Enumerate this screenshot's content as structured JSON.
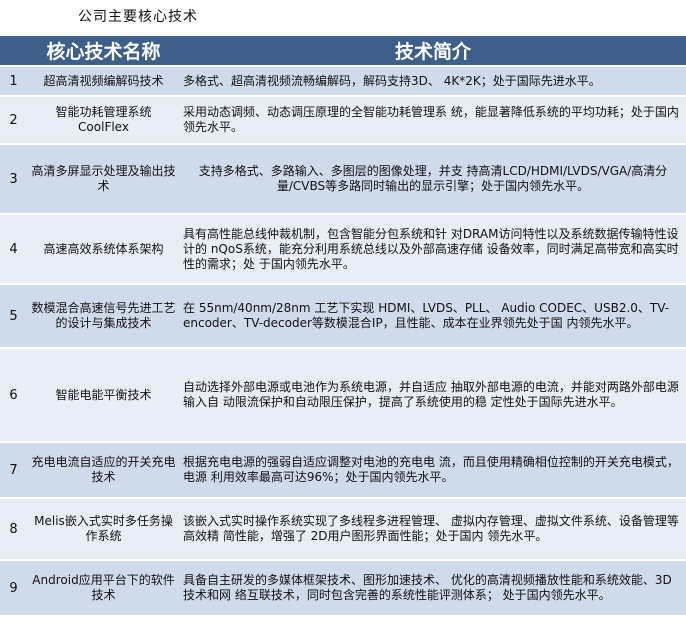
{
  "page": {
    "title": "公司主要核心技术"
  },
  "table": {
    "headers": {
      "num": "",
      "name": "核心技术名称",
      "desc": "技术简介"
    },
    "rows": [
      {
        "num": "1",
        "name": "超高清视频编解码技术",
        "desc": "多格式、超高清视频流畅编解码，解码支持3D、 4K*2K；处于国际先进水平。"
      },
      {
        "num": "2",
        "name": "智能功耗管理系统 CoolFlex",
        "desc": "采用动态调频、动态调压原理的全智能功耗管理系 统，能显著降低系统的平均功耗；处于国内领先水平。"
      },
      {
        "num": "3",
        "name": "高清多屏显示处理及输出技术",
        "desc": "支持多格式、多路输入、多图层的图像处理，并支 持高清LCD/HDMI/LVDS/VGA/高清分量/CVBS等多路同时输出的显示引擎；处于国内领先水平。"
      },
      {
        "num": "4",
        "name": "高速高效系统体系架构",
        "desc": "具有高性能总线仲裁机制，包含智能分包系统和针 对DRAM访问特性以及系统数据传输特性设计的 nQoS系统，能充分利用系统总线以及外部高速存储 设备效率，同时满足高带宽和高实时性的需求；处 于国内领先水平。"
      },
      {
        "num": "5",
        "name": "数模混合高速信号先进工艺的设计与集成技术",
        "desc": "在 55nm/40nm/28nm 工艺下实现 HDMI、LVDS、PLL、 Audio CODEC、USB2.0、TV-encoder、TV-decoder等数模混合IP，且性能、成本在业界领先处于国 内领先水平。"
      },
      {
        "num": "6",
        "name": "智能电能平衡技术",
        "desc": "自动选择外部电源或电池作为系统电源，并自适应 抽取外部电源的电流，并能对两路外部电源输入自 动限流保护和自动限压保护，提高了系统使用的稳 定性处于国际先进水平。"
      },
      {
        "num": "7",
        "name": "充电电流自适应的开关充电技术",
        "desc": "根据充电电源的强弱自适应调整对电池的充电电 流，而且使用精确相位控制的开关充电模式，电源 利用效率最高可达96%；处于国内领先水平。"
      },
      {
        "num": "8",
        "name": "Melis嵌入式实时多任务操作系统",
        "desc": "该嵌入式实时操作系统实现了多线程多进程管理、 虚拟内存管理、虚拟文件系统、设备管理等高效精 简性能，增强了 2D用户图形界面性能；处于国内 领先水平。"
      },
      {
        "num": "9",
        "name": "Android应用平台下的软件技术",
        "desc": "具备自主研发的多媒体框架技术、图形加速技术、 优化的高清视频播放性能和系统效能、3D技术和网 络互联技术，同时包含完善的系统性能评测体系； 处于国内领先水平。"
      }
    ]
  }
}
